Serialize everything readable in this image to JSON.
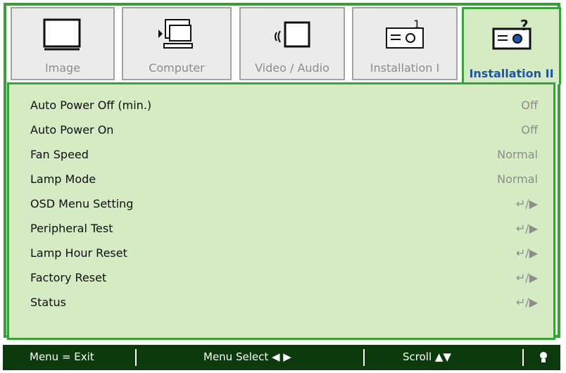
{
  "tabs": [
    {
      "label": "Image",
      "icon": "monitor-icon",
      "active": false
    },
    {
      "label": "Computer",
      "icon": "computer-icon",
      "active": false
    },
    {
      "label": "Video / Audio",
      "icon": "video-audio-icon",
      "active": false
    },
    {
      "label": "Installation I",
      "icon": "projector-icon",
      "active": false
    },
    {
      "label": "Installation II",
      "icon": "projector-help-icon",
      "active": true
    }
  ],
  "rows": [
    {
      "name": "Auto Power Off (min.)",
      "value": "Off"
    },
    {
      "name": "Auto Power On",
      "value": "Off"
    },
    {
      "name": "Fan Speed",
      "value": "Normal"
    },
    {
      "name": "Lamp Mode",
      "value": "Normal"
    },
    {
      "name": "OSD Menu Setting",
      "value": "↵/▶"
    },
    {
      "name": "Peripheral Test",
      "value": "↵/▶"
    },
    {
      "name": "Lamp Hour Reset",
      "value": "↵/▶"
    },
    {
      "name": "Factory Reset",
      "value": "↵/▶"
    },
    {
      "name": "Status",
      "value": "↵/▶"
    }
  ],
  "footer": {
    "exit": "Menu = Exit",
    "select": "Menu Select ◀ ▶",
    "scroll": "Scroll ▲▼",
    "hint_icon": "bulb-icon"
  },
  "colors": {
    "accent": "#3aa13a",
    "panel": "#d4ebc4",
    "footer": "#0c3a0c",
    "active_label": "#1a56a8"
  }
}
